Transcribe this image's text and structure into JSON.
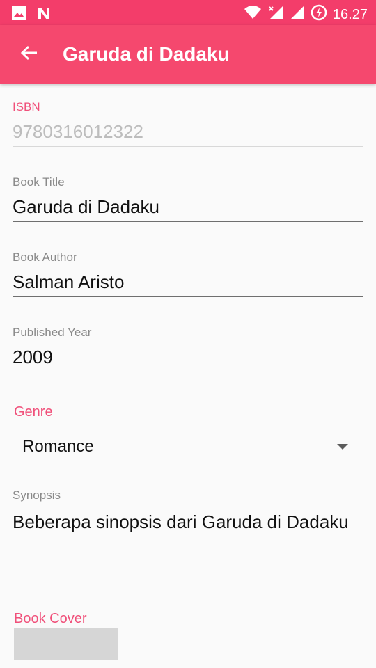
{
  "status_bar": {
    "time": "16.27"
  },
  "app_bar": {
    "title": "Garuda di Dadaku"
  },
  "form": {
    "isbn": {
      "label": "ISBN",
      "value": "9780316012322"
    },
    "title": {
      "label": "Book Title",
      "value": "Garuda di Dadaku"
    },
    "author": {
      "label": "Book Author",
      "value": "Salman Aristo"
    },
    "year": {
      "label": "Published Year",
      "value": "2009"
    },
    "genre": {
      "label": "Genre",
      "value": "Romance"
    },
    "synopsis": {
      "label": "Synopsis",
      "value": "Beberapa sinopsis dari Garuda di Dadaku"
    },
    "cover": {
      "label": "Book Cover"
    }
  },
  "colors": {
    "accent": "#f5486e",
    "status": "#f33d6a",
    "label_accent": "#f0507a"
  }
}
